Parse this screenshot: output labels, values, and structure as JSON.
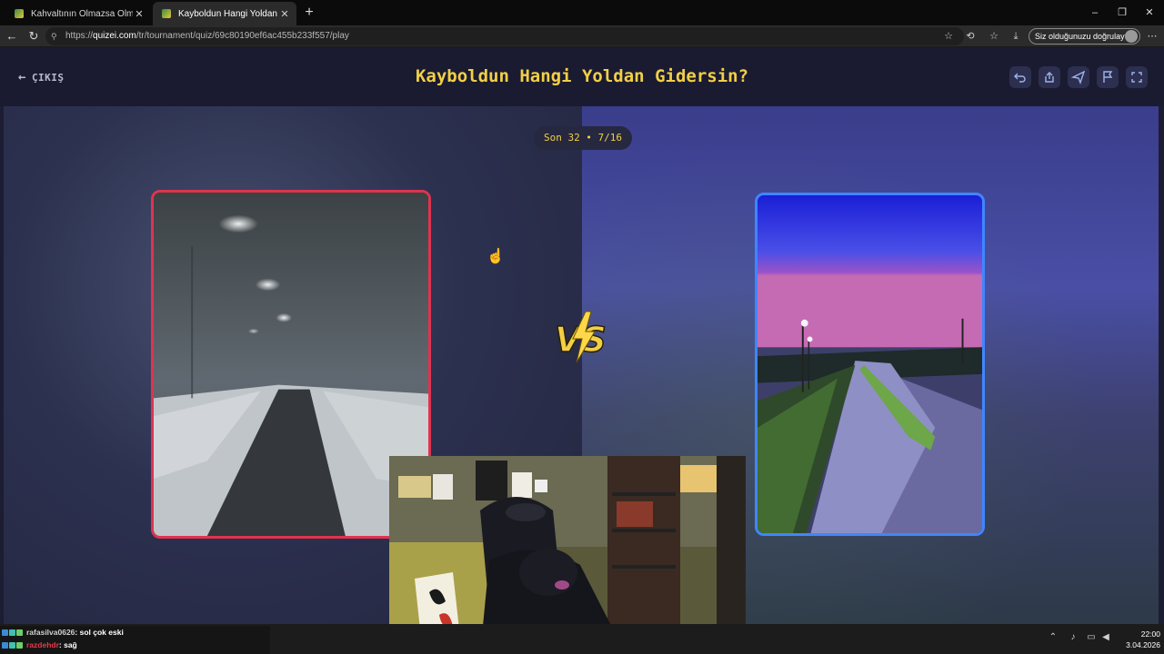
{
  "browser": {
    "tabs": [
      {
        "label": "Kahvaltının Olmazsa Olmazı - Tier",
        "close": "✕"
      },
      {
        "label": "Kayboldun Hangi Yoldan Gidersin?",
        "close": "✕"
      }
    ],
    "new_tab": "+",
    "window_controls": {
      "minimize": "–",
      "maximize": "❐",
      "close": "✕"
    },
    "url_prefix": "https://",
    "url_domain": "quizei.com",
    "url_path": "/tr/tournament/quiz/69c80190ef6ac455b233f557/play",
    "signin_label": "Siz olduğunuzu doğrulayın"
  },
  "header": {
    "exit_label": "ÇIKIŞ",
    "title": "Kayboldun Hangi Yoldan Gidersin?",
    "tools": [
      "undo-icon",
      "share-icon",
      "send-icon",
      "flag-icon",
      "fullscreen-icon"
    ]
  },
  "round_label": "Son 32 • 7/16",
  "vs_label": "VS",
  "chat": [
    {
      "user": "rafasilva0626",
      "message": ": sol çok eski"
    },
    {
      "user": "razdehdr",
      "message": ": sağ"
    }
  ],
  "clock": {
    "time": "22:00",
    "date": "3.04.2026"
  },
  "colors": {
    "accent": "#f2cf47",
    "left_card": "#e0334f",
    "right_card": "#3f86ff"
  }
}
